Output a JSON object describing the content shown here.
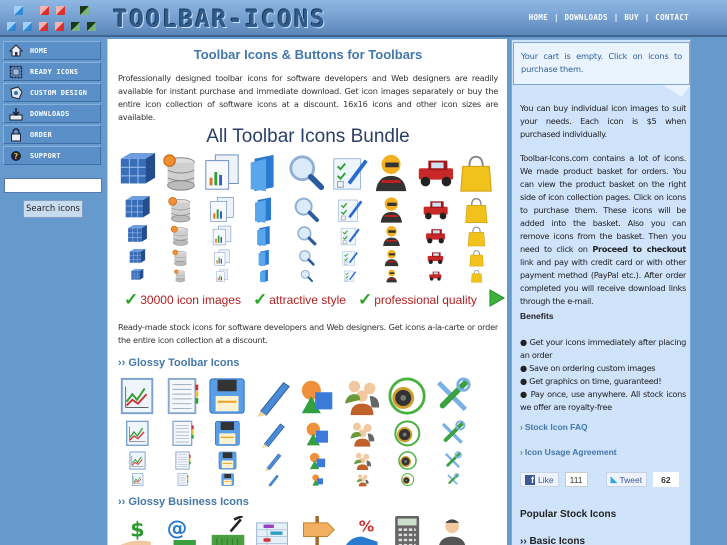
{
  "header": {
    "logo_text": "TOOLBAR-ICONS",
    "nav": [
      {
        "label": "HOME"
      },
      {
        "label": "DOWNLOADS"
      },
      {
        "label": "BUY"
      },
      {
        "label": "CONTACT"
      }
    ],
    "separator": "|"
  },
  "sidebar": {
    "items": [
      {
        "label": "HOME",
        "icon": "house-icon"
      },
      {
        "label": "READY ICONS",
        "icon": "picture-frame-icon"
      },
      {
        "label": "CUSTOM DESIGN",
        "icon": "palette-icon"
      },
      {
        "label": "DOWNLOADS",
        "icon": "download-tray-icon"
      },
      {
        "label": "ORDER",
        "icon": "lock-icon"
      },
      {
        "label": "SUPPORT",
        "icon": "support-icon"
      }
    ],
    "search_value": "",
    "search_button": "Search icons"
  },
  "main": {
    "title": "Toolbar Icons & Buttons for Toolbars",
    "intro": "Professionally designed toolbar icons for software developers and Web designers are readily available for instant purchase and immediate download. Get icon images separately or buy the entire icon collection of software icons at a discount. 16x16 icons and other icon sizes are available.",
    "bundle_title": "All Toolbar Icons Bundle",
    "bundle_icons": [
      "cube-icon",
      "database-gear-icon",
      "report-chart-icon",
      "folder-icon",
      "magnifier-icon",
      "checklist-icon",
      "racer-icon",
      "jeep-icon",
      "shopping-bag-icon"
    ],
    "features": [
      {
        "label": "30000 icon images"
      },
      {
        "label": "attractive style"
      },
      {
        "label": "professional quality"
      }
    ],
    "ready_made": "Ready-made stock icons for software developers and Web designers. Get icons a-la-carte or order the entire icon collection at a discount.",
    "sections": [
      {
        "title": "›› Glossy Toolbar Icons",
        "icons": [
          "chart-icon",
          "notebook-icon",
          "floppy-disk-icon",
          "pencil-icon",
          "shapes-icon",
          "users-icon",
          "speaker-icon",
          "tools-icon"
        ]
      },
      {
        "title": "›› Glossy Business Icons",
        "icons": [
          "money-hand-icon",
          "email-phone-icon",
          "basket-icon",
          "gantt-chart-icon",
          "signpost-icon",
          "car-discount-icon",
          "calculator-icon",
          "businessman-icon"
        ]
      }
    ]
  },
  "right": {
    "cart": "Your cart is empty. Click on icons to purchase them.",
    "p1": "You can buy individual icon images to suit your needs. Each icon is $5 when purchased individually.",
    "p2_a": "Toolbar-Icons.com contains a lot of icons. We made product basket for orders. You can view the product basket on the right side of icon collection pages. Click on icons to purchase them. These icons will be added into the basket. Also you can remove icons from the basket. Then you need to click on ",
    "p2_bold": "Proceed to checkout",
    "p2_b": " link and pay with credit card or with other payment method (PayPal etc.). After order completed you will receive download links through the e-mail.",
    "benefits_title": "Benefits",
    "benefits": [
      "Get your icons immediately after placing an order",
      "Save on ordering custom images",
      "Get graphics on time, guaranteed!",
      "Pay once, use anywhere. All stock icons we offer are royalty-free"
    ],
    "links": [
      {
        "label": "Stock Icon FAQ"
      },
      {
        "label": "Icon Usage Agreement"
      }
    ],
    "social": {
      "like_label": "Like",
      "like_count": "111",
      "tweet_label": "Tweet",
      "tweet_count": "62"
    },
    "popular_title": "Popular Stock Icons",
    "popular_first": "›› Basic Icons"
  },
  "colors": {
    "accent": "#4477aa",
    "background": "#6699cc",
    "panel": "#cfe3fa",
    "feature_text": "#b32020",
    "check": "#2aa52a"
  }
}
